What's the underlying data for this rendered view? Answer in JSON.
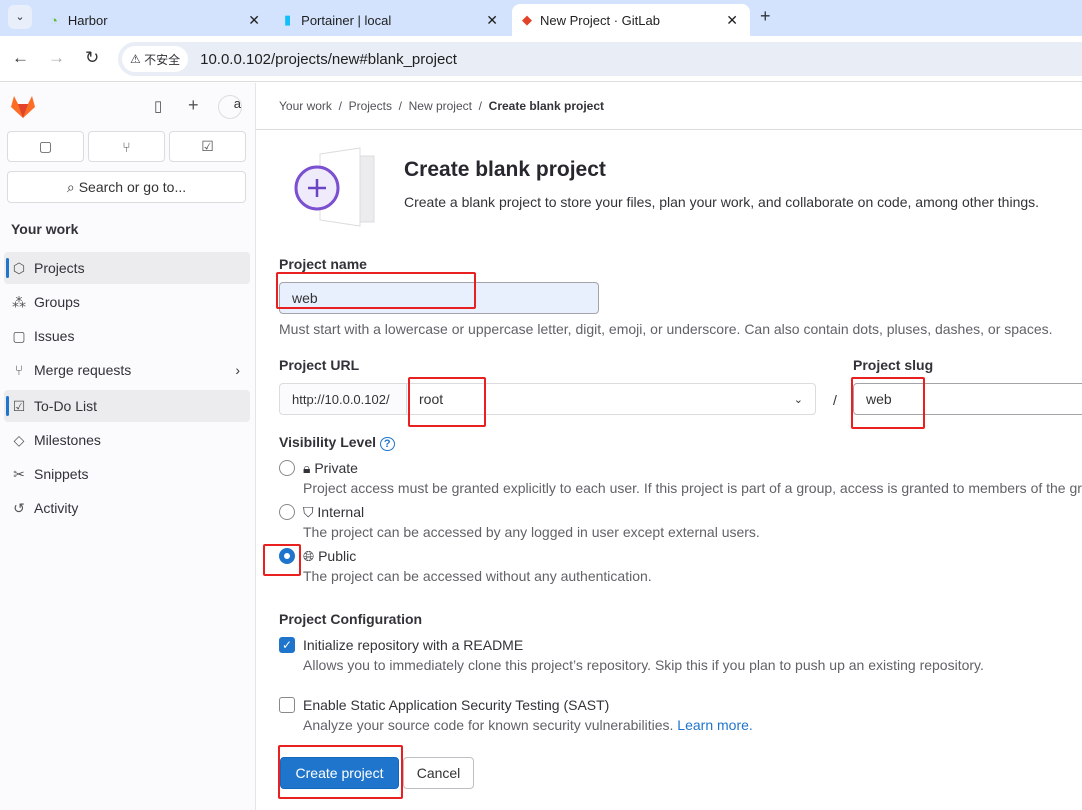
{
  "browser": {
    "tabs": [
      {
        "label": "Harbor"
      },
      {
        "label": "Portainer | local"
      },
      {
        "label": "New Project · GitLab",
        "active": true
      }
    ],
    "security_label": "不安全",
    "url": "10.0.0.102/projects/new#blank_project"
  },
  "sidebar": {
    "search_label": "Search or go to...",
    "section_title": "Your work",
    "avatar_alt": "a",
    "items": [
      {
        "label": "Projects"
      },
      {
        "label": "Groups"
      },
      {
        "label": "Issues"
      },
      {
        "label": "Merge requests"
      },
      {
        "label": "To-Do List"
      },
      {
        "label": "Milestones"
      },
      {
        "label": "Snippets"
      },
      {
        "label": "Activity"
      }
    ]
  },
  "breadcrumb": [
    "Your work",
    "Projects",
    "New project",
    "Create blank project"
  ],
  "header": {
    "title": "Create blank project",
    "description": "Create a blank project to store your files, plan your work, and collaborate on code, among other things."
  },
  "form": {
    "project_name_label": "Project name",
    "project_name_value": "web",
    "project_name_help": "Must start with a lowercase or uppercase letter, digit, emoji, or underscore. Can also contain dots, pluses, dashes, or spaces.",
    "project_url_label": "Project URL",
    "url_prefix": "http://10.0.0.102/",
    "namespace": "root",
    "slug_separator": "/",
    "project_slug_label": "Project slug",
    "project_slug_value": "web",
    "visibility_label": "Visibility Level",
    "visibility": [
      {
        "label": "Private",
        "desc": "Project access must be granted explicitly to each user. If this project is part of a group, access is granted to members of the group."
      },
      {
        "label": "Internal",
        "desc": "The project can be accessed by any logged in user except external users."
      },
      {
        "label": "Public",
        "desc": "The project can be accessed without any authentication.",
        "selected": true
      }
    ],
    "config_label": "Project Configuration",
    "readme_label": "Initialize repository with a README",
    "readme_desc": "Allows you to immediately clone this project’s repository. Skip this if you plan to push up an existing repository.",
    "readme_checked": true,
    "sast_label": "Enable Static Application Security Testing (SAST)",
    "sast_desc": "Analyze your source code for known security vulnerabilities.",
    "learn_more": "Learn more.",
    "sast_checked": false,
    "create_button": "Create project",
    "cancel_button": "Cancel"
  },
  "colors": {
    "accent": "#1f75cb",
    "annotation": "#e8201f"
  }
}
